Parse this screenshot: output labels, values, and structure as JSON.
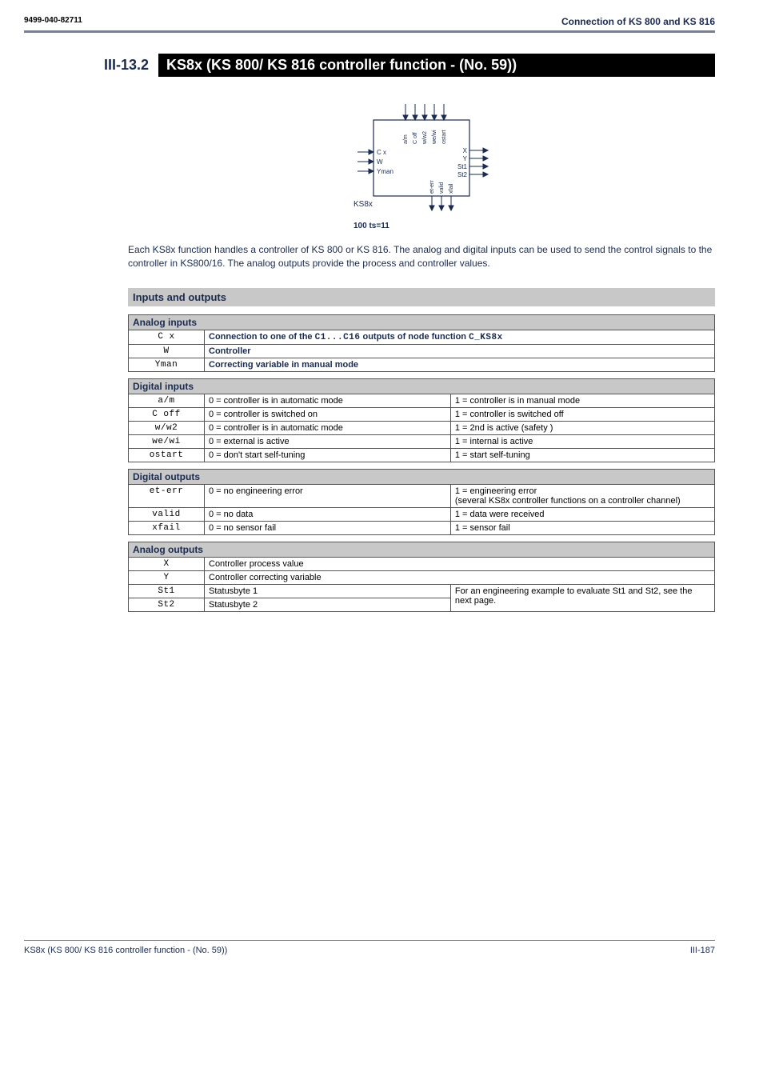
{
  "header": {
    "doc_id": "9499-040-82711",
    "section_title": "Connection of KS 800 and KS 816"
  },
  "heading": {
    "number": "III-13.2",
    "title": "KS8x (KS 800/ KS 816 controller function - (No. 59))"
  },
  "diagram": {
    "top_inputs": [
      "a/m",
      "C off",
      "w/w2",
      "we/wi",
      "ostart"
    ],
    "left_inputs": [
      "C x",
      "W",
      "Yman"
    ],
    "bottom_outputs": [
      "et-err",
      "valid",
      "xfail"
    ],
    "right_outputs": [
      "X",
      "Y",
      "St1",
      "St2"
    ],
    "block_label": "KS8x",
    "caption": "100 ts=11"
  },
  "body_text": "Each KS8x function handles  a controller of KS 800 or KS 816. The analog and digital inputs can be used to send the control signals to the controller in KS800/16. The analog outputs provide the process and controller values.",
  "io_heading": "Inputs and outputs",
  "analog_inputs": {
    "title": "Analog inputs",
    "rows": [
      {
        "sig": "C x",
        "desc_prefix": "Connection to one of the ",
        "desc_code": "C1...C16",
        "desc_mid": " outputs of node function ",
        "desc_code2": "C_KS8x"
      },
      {
        "sig": "W",
        "desc": "Controller"
      },
      {
        "sig": "Yman",
        "desc": "Correcting variable in manual mode"
      }
    ]
  },
  "digital_inputs": {
    "title": "Digital inputs",
    "rows": [
      {
        "sig": "a/m",
        "v0": "0 = controller is in automatic mode",
        "v1": "1 = controller is in manual mode"
      },
      {
        "sig": "C off",
        "v0": "0 = controller is switched on",
        "v1": "1 = controller is switched off"
      },
      {
        "sig": "w/w2",
        "v0": "0 = controller is in automatic mode",
        "v1": "1 = 2nd  is active (safety )"
      },
      {
        "sig": "we/wi",
        "v0": "0 = external  is active",
        "v1": "1 = internal  is active"
      },
      {
        "sig": "ostart",
        "v0": "0 = don't start self-tuning",
        "v1": "1 = start self-tuning"
      }
    ]
  },
  "digital_outputs": {
    "title": "Digital outputs",
    "rows": [
      {
        "sig": "et-err",
        "v0": "0 = no engineering error",
        "v1": "1 = engineering error\n(several KS8x controller functions on a controller channel)"
      },
      {
        "sig": "valid",
        "v0": "0 = no data",
        "v1": "1 = data were received"
      },
      {
        "sig": "xfail",
        "v0": "0 = no sensor fail",
        "v1": "1 = sensor fail"
      }
    ]
  },
  "analog_outputs": {
    "title": "Analog outputs",
    "rows": [
      {
        "sig": "X",
        "desc": "Controller process value"
      },
      {
        "sig": "Y",
        "desc": "Controller correcting variable"
      },
      {
        "sig": "St1",
        "desc": "Statusbyte 1",
        "note": "For an engineering example to evaluate St1 and St2, see the"
      },
      {
        "sig": "St2",
        "desc": "Statusbyte 2",
        "note": "next page."
      }
    ]
  },
  "footer": {
    "left": "KS8x (KS 800/ KS 816 controller function - (No. 59))",
    "right": "III-187"
  }
}
